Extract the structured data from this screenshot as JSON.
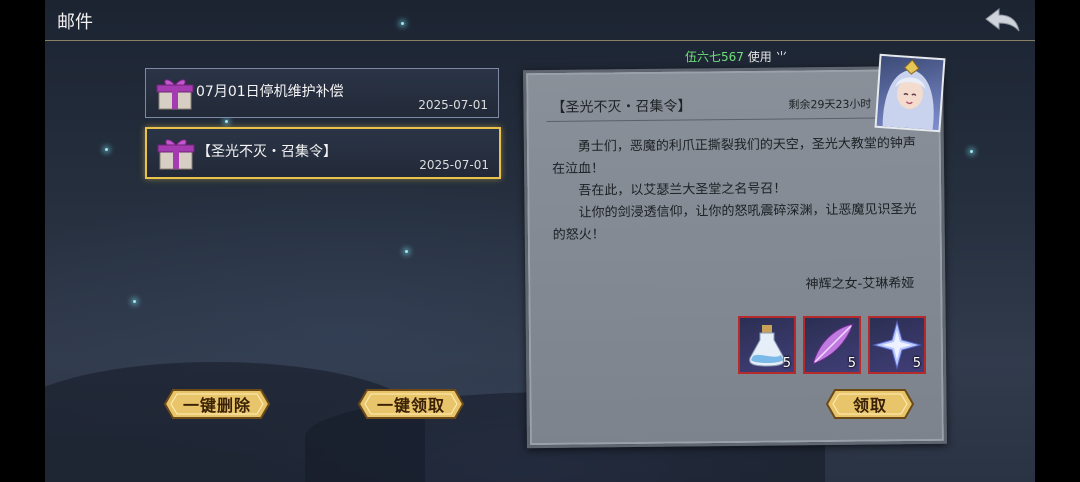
{
  "header": {
    "title": "邮件"
  },
  "marquee": {
    "name": "伍六七567",
    "text": "使用 ⺌"
  },
  "mail_list": [
    {
      "title": "07月01日停机维护补偿",
      "date": "2025-07-01"
    },
    {
      "title": "【圣光不灭・召集令】",
      "date": "2025-07-01"
    }
  ],
  "actions": {
    "delete_all": "一键删除",
    "claim_all": "一键领取",
    "claim": "领取"
  },
  "letter": {
    "title": "【圣光不灭・召集令】",
    "remaining": "剩余29天23小时",
    "paragraphs": [
      "勇士们，恶魔的利爪正撕裂我们的天空，圣光大教堂的钟声在泣血！",
      "吾在此，以艾瑟兰大圣堂之名号召！",
      "让你的剑浸透信仰，让你的怒吼震碎深渊，让恶魔见识圣光的怒火！"
    ],
    "signature": "神辉之女-艾琳希娅"
  },
  "rewards": [
    {
      "icon": "potion-icon",
      "count": "5"
    },
    {
      "icon": "feather-icon",
      "count": "5"
    },
    {
      "icon": "crystal-star-icon",
      "count": "5"
    }
  ],
  "colors": {
    "selected_border": "#e8c24a",
    "button_gold": "#e8c46a",
    "reward_border": "#b52b2b",
    "marquee_name": "#6fe07a"
  }
}
